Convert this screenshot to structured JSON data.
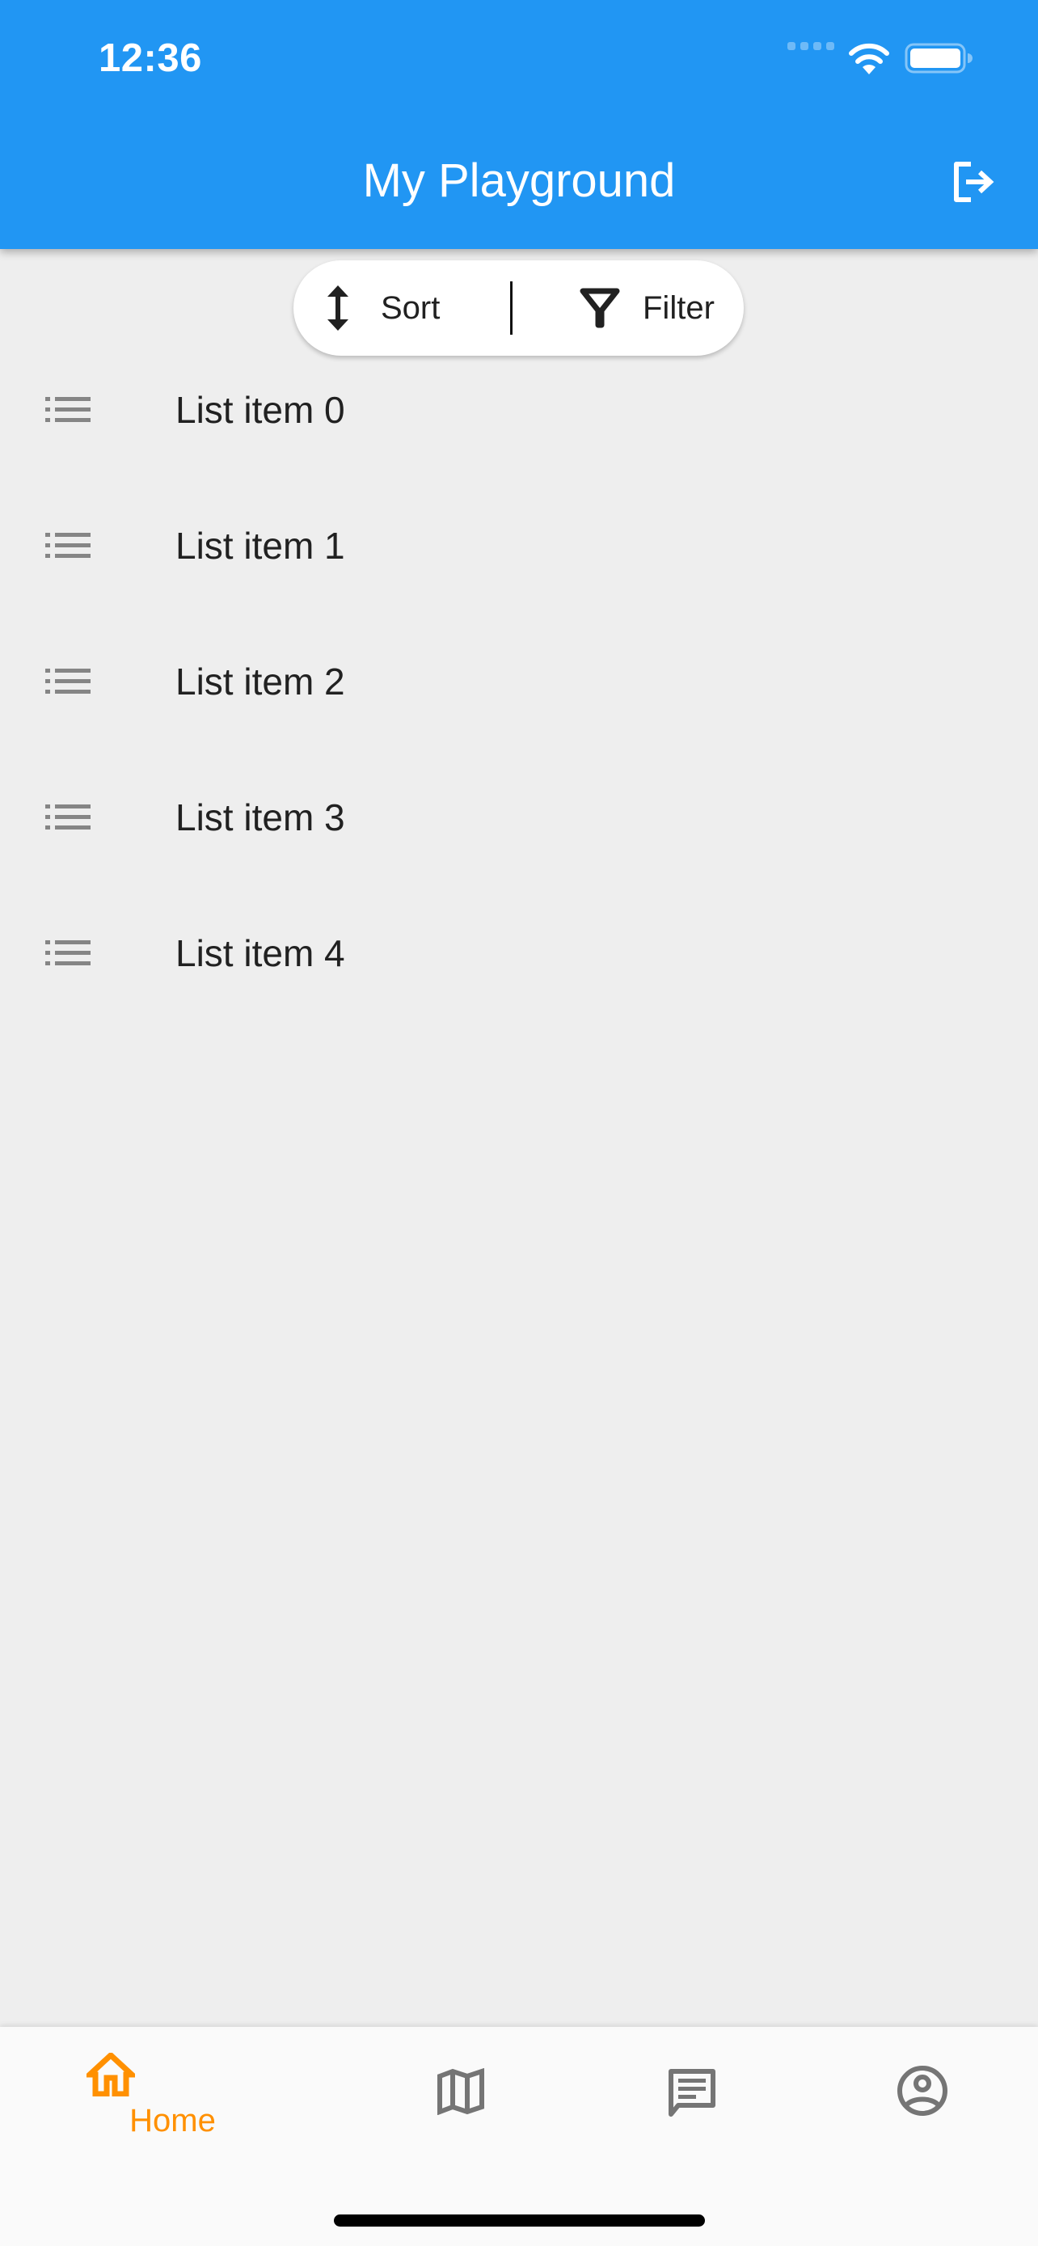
{
  "status_bar": {
    "time": "12:36",
    "icons": [
      "signal-icon",
      "wifi-icon",
      "battery-icon"
    ]
  },
  "app_bar": {
    "title": "My Playground",
    "action_icon": "logout-icon"
  },
  "toolbar": {
    "sort_label": "Sort",
    "sort_icon": "sort-vertical-arrows-icon",
    "filter_label": "Filter",
    "filter_icon": "filter-funnel-icon"
  },
  "list": {
    "item_icon": "list-icon",
    "items": [
      {
        "label": "List item 0"
      },
      {
        "label": "List item 1"
      },
      {
        "label": "List item 2"
      },
      {
        "label": "List item 3"
      },
      {
        "label": "List item 4"
      }
    ]
  },
  "bottom_nav": {
    "active_color": "#ff9000",
    "inactive_color": "#757575",
    "items": [
      {
        "id": "home",
        "label": "Home",
        "icon": "home-icon",
        "active": true
      },
      {
        "id": "map",
        "label": "",
        "icon": "map-icon",
        "active": false
      },
      {
        "id": "messages",
        "label": "",
        "icon": "chat-icon",
        "active": false
      },
      {
        "id": "account",
        "label": "",
        "icon": "account-circle-icon",
        "active": false
      }
    ]
  },
  "theme": {
    "primary": "#2196f3",
    "background": "#eeeeee",
    "text": "#212121",
    "icon_grey": "#858585"
  }
}
